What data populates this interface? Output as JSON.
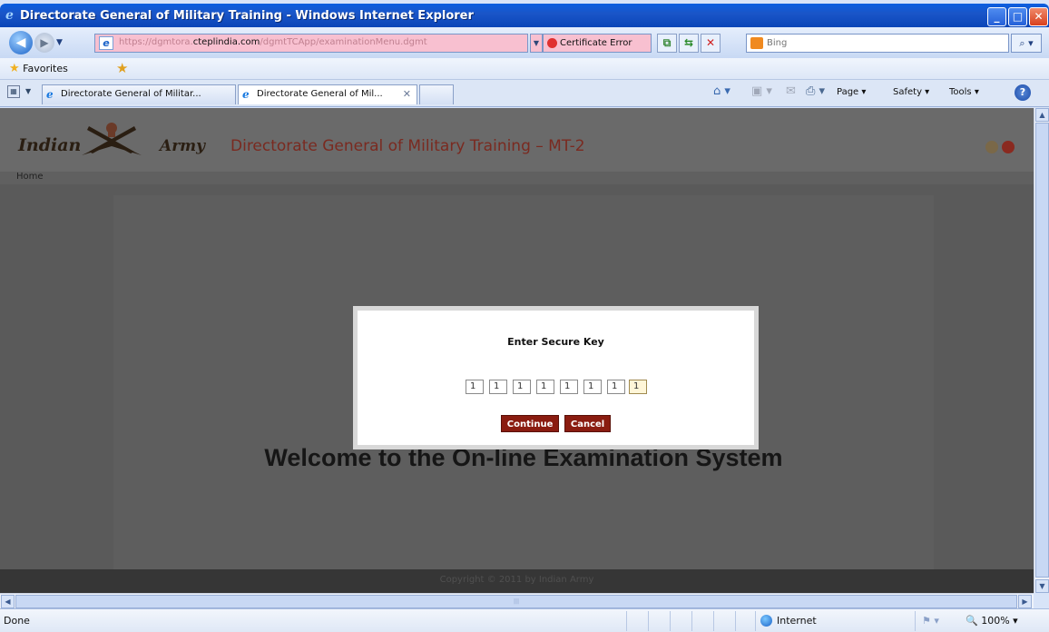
{
  "window": {
    "title": "Directorate General of Military Training - Windows Internet Explorer",
    "controls": {
      "minimize": "_",
      "maximize": "□",
      "close": "✕"
    }
  },
  "navbar": {
    "back_icon": "arrow-left-icon",
    "forward_icon": "arrow-right-icon",
    "address": {
      "prefix": "https://dgmtora.",
      "domain": "cteplindia.com",
      "path": "/dgmtTCApp/examinationMenu.dgmt"
    },
    "certificate_error": "Certificate Error",
    "search_placeholder": "Bing"
  },
  "favorites_bar": {
    "label": "Favorites"
  },
  "tabs": [
    {
      "label": "Directorate General of Militar..."
    },
    {
      "label": "Directorate General of Mil...",
      "active": true
    }
  ],
  "command_bar": {
    "page": "Page ▾",
    "safety": "Safety ▾",
    "tools": "Tools ▾",
    "help": "?"
  },
  "site": {
    "logo_left": "Indian",
    "logo_right": "Army",
    "title": "Directorate General of Military Training – MT-2",
    "breadcrumb_home": "Home",
    "welcome": "Welcome to the On-line Examination System",
    "copyright": "Copyright © 2011 by Indian Army"
  },
  "modal": {
    "title": "Enter Secure Key",
    "keys": [
      "1",
      "1",
      "1",
      "1",
      "1",
      "1",
      "1",
      "1"
    ],
    "continue_label": "Continue",
    "cancel_label": "Cancel"
  },
  "statusbar": {
    "status": "Done",
    "zone": "Internet",
    "zoom": "100%"
  },
  "colors": {
    "title_bar": "#1a55c8",
    "address_error": "#f8c0d0",
    "site_title": "#7a2a20",
    "button_bg": "#8a1c10",
    "overlay_bg": "#5a5a5a"
  }
}
